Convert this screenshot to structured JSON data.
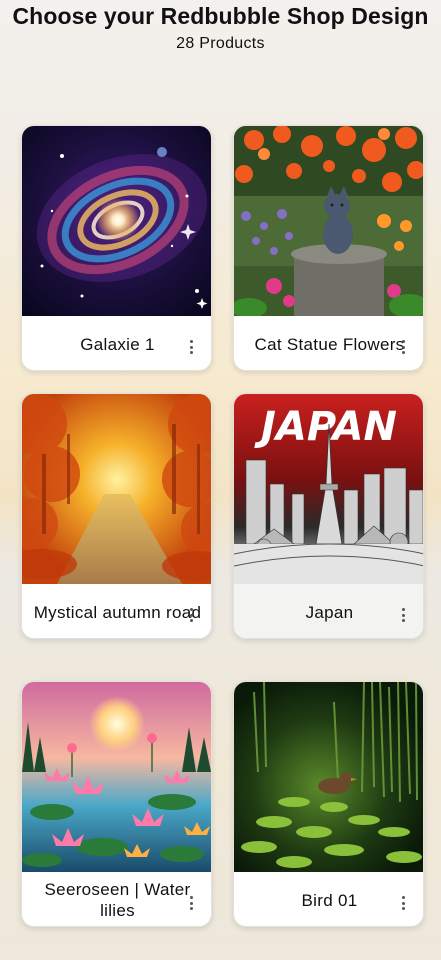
{
  "header": {
    "title": "Choose your Redbubble Shop Design",
    "product_count": "28 Products"
  },
  "products": [
    {
      "label": "Galaxie 1",
      "image": "spiral galaxy",
      "menu_icon": "more-vertical-icon"
    },
    {
      "label": "Cat Statue Flowers",
      "image": "cat statue among flowers",
      "menu_icon": "more-vertical-icon"
    },
    {
      "label": "Mystical autumn road",
      "image": "autumn road",
      "menu_icon": "more-vertical-icon"
    },
    {
      "label": "Japan",
      "image": "Japan city skyline",
      "image_text": "JAPAN",
      "menu_icon": "more-vertical-icon"
    },
    {
      "label": "Seeroseen | Water lilies",
      "image": "water lilies at sunset",
      "menu_icon": "more-vertical-icon"
    },
    {
      "label": "Bird 01",
      "image": "duck in pond",
      "menu_icon": "more-vertical-icon"
    }
  ]
}
